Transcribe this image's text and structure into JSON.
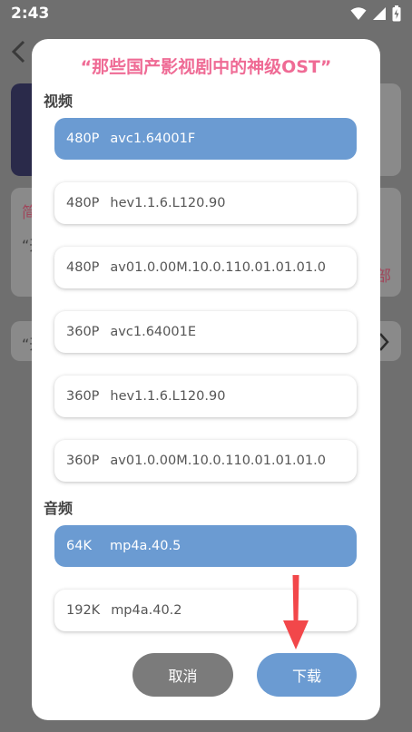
{
  "status_bar": {
    "time": "2:43"
  },
  "background": {
    "card2_red_text": "简",
    "card2_quote": "“开",
    "card2_red_text_right": "部",
    "card3_quote": "“开"
  },
  "dialog": {
    "title": "“那些国产影视剧中的神级OST”",
    "video_section": {
      "label": "视频",
      "options": [
        {
          "resolution": "480P",
          "codec": "avc1.64001F",
          "selected": true
        },
        {
          "resolution": "480P",
          "codec": "hev1.1.6.L120.90",
          "selected": false
        },
        {
          "resolution": "480P",
          "codec": "av01.0.00M.10.0.110.01.01.01.0",
          "selected": false
        },
        {
          "resolution": "360P",
          "codec": "avc1.64001E",
          "selected": false
        },
        {
          "resolution": "360P",
          "codec": "hev1.1.6.L120.90",
          "selected": false
        },
        {
          "resolution": "360P",
          "codec": "av01.0.00M.10.0.110.01.01.01.0",
          "selected": false
        }
      ]
    },
    "audio_section": {
      "label": "音频",
      "options": [
        {
          "bitrate": "64K",
          "codec": "mp4a.40.5",
          "selected": true
        },
        {
          "bitrate": "192K",
          "codec": "mp4a.40.2",
          "selected": false
        }
      ]
    },
    "cancel_label": "取消",
    "download_label": "下载"
  },
  "colors": {
    "title": "#ef6b95",
    "selected": "#6b9bd2",
    "cancel": "#7b7b7b",
    "arrow": "#f2474a"
  }
}
